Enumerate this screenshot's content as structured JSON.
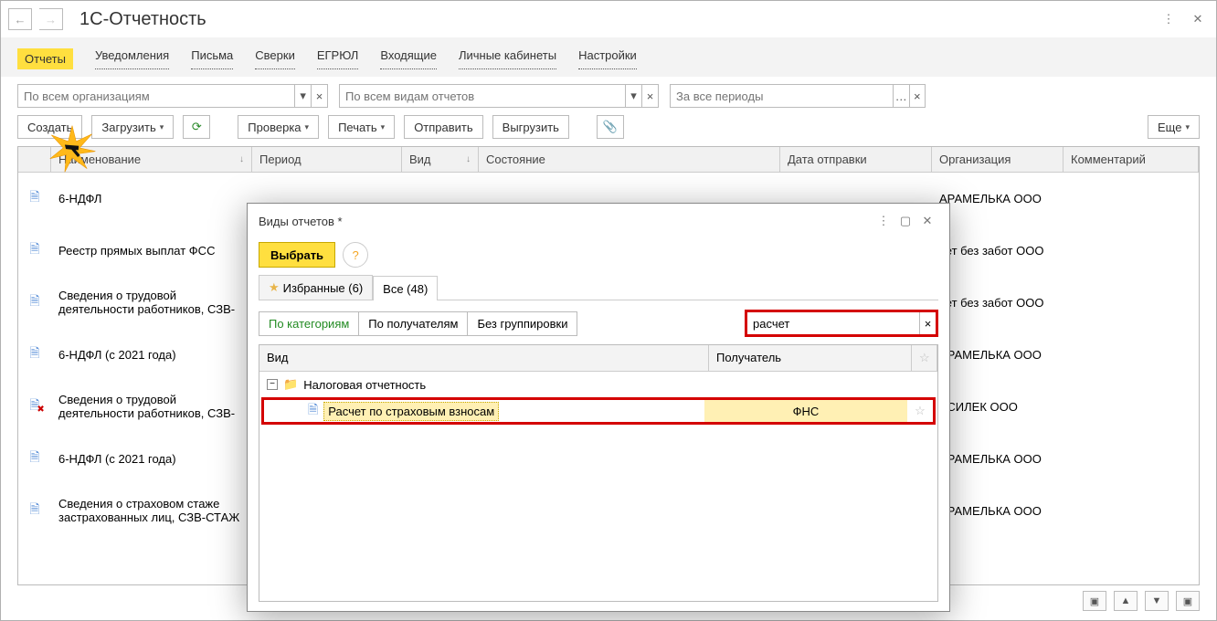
{
  "header": {
    "title": "1С-Отчетность"
  },
  "tabs": {
    "items": [
      "Отчеты",
      "Уведомления",
      "Письма",
      "Сверки",
      "ЕГРЮЛ",
      "Входящие",
      "Личные кабинеты",
      "Настройки"
    ]
  },
  "filters": {
    "org_placeholder": "По всем организациям",
    "kind_placeholder": "По всем видам отчетов",
    "period_placeholder": "За все периоды"
  },
  "actions": {
    "create": "Создать",
    "load": "Загрузить",
    "check": "Проверка",
    "print": "Печать",
    "send": "Отправить",
    "export": "Выгрузить",
    "more": "Еще"
  },
  "grid": {
    "cols": {
      "name": "Наименование",
      "period": "Период",
      "kind": "Вид",
      "state": "Состояние",
      "send_date": "Дата отправки",
      "org": "Организация",
      "comment": "Комментарий"
    },
    "rows": [
      {
        "icon": "doc",
        "name": "6-НДФЛ",
        "org": "АРАМЕЛЬКА ООО"
      },
      {
        "icon": "doc",
        "name": "Реестр прямых выплат ФСС",
        "org": "чет без забот ООО"
      },
      {
        "icon": "doc",
        "name": "Сведения о трудовой деятельности работников, СЗВ-",
        "org": "чет без забот ООО"
      },
      {
        "icon": "doc",
        "name": "6-НДФЛ (с 2021 года)",
        "org": "АРАМЕЛЬКА ООО"
      },
      {
        "icon": "doc-x",
        "name": "Сведения о трудовой деятельности работников, СЗВ-",
        "org": "АСИЛЕК ООО"
      },
      {
        "icon": "doc",
        "name": "6-НДФЛ (с 2021 года)",
        "org": "АРАМЕЛЬКА ООО"
      },
      {
        "icon": "doc",
        "name": "Сведения о страховом стаже застрахованных лиц, СЗВ-СТАЖ",
        "org": "АРАМЕЛЬКА ООО"
      }
    ]
  },
  "modal": {
    "title": "Виды отчетов *",
    "select_btn": "Выбрать",
    "tab_fav": "Избранные (6)",
    "tab_all": "Все (48)",
    "seg_by_cat": "По категориям",
    "seg_by_rcpt": "По получателям",
    "seg_no_group": "Без группировки",
    "search_value": "расчет",
    "col_kind": "Вид",
    "col_rcpt": "Получатель",
    "group_label": "Налоговая отчетность",
    "sel_label": "Расчет по страховым взносам",
    "sel_rcpt": "ФНС"
  }
}
